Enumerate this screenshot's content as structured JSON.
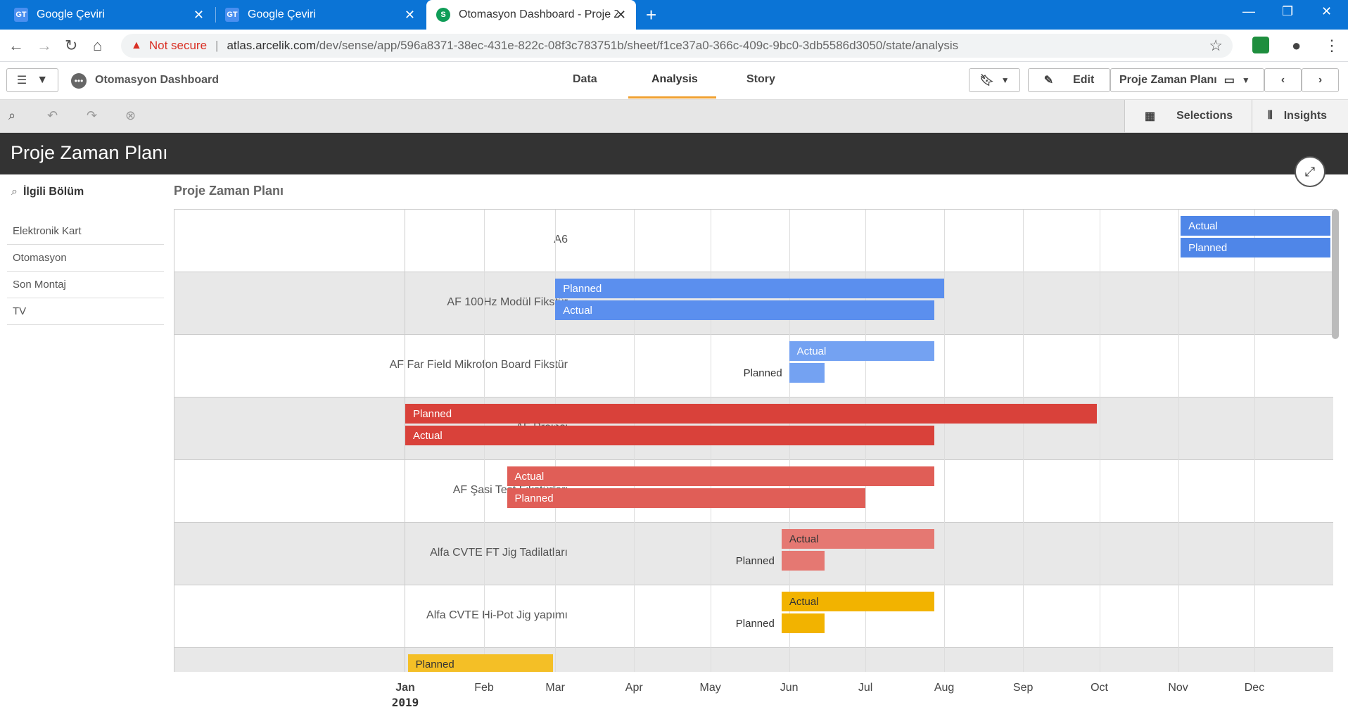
{
  "browser": {
    "tabs": [
      {
        "title": "Google Çeviri",
        "favicon": "GT"
      },
      {
        "title": "Google Çeviri",
        "favicon": "GT"
      },
      {
        "title": "Otomasyon Dashboard - Proje Za",
        "favicon": "S"
      }
    ],
    "new_tab": "+",
    "not_secure": "Not secure",
    "url_host": "atlas.arcelik.com",
    "url_path": "/dev/sense/app/596a8371-38ec-431e-822c-08f3c783751b/sheet/f1ce37a0-366c-409c-9bc0-3db5586d3050/state/analysis"
  },
  "app": {
    "name": "Otomasyon Dashboard",
    "nav_tabs": [
      "Data",
      "Analysis",
      "Story"
    ],
    "active_tab": "Analysis",
    "edit_label": "Edit",
    "sheet_selector": "Proje Zaman Planı",
    "selections_label": "Selections",
    "insights_label": "Insights"
  },
  "sheet": {
    "title": "Proje Zaman Planı"
  },
  "filter": {
    "title": "İlgili Bölüm",
    "items": [
      "Elektronik Kart",
      "Otomasyon",
      "Son Montaj",
      "TV"
    ]
  },
  "chart_data": {
    "type": "gantt",
    "title": "Proje Zaman Planı",
    "x_ticks": [
      "Jan",
      "Feb",
      "Mar",
      "Apr",
      "May",
      "Jun",
      "Jul",
      "Aug",
      "Sep",
      "Oct",
      "Nov",
      "Dec"
    ],
    "x_year": "2019",
    "rows": [
      {
        "name": "A6",
        "color": "#4f86e8",
        "bars": [
          {
            "label": "Actual",
            "start": "2019-11-02",
            "end": "2019-12-31"
          },
          {
            "label": "Planned",
            "start": "2019-11-02",
            "end": "2019-12-31"
          }
        ]
      },
      {
        "name": "AF 100Hz Modül Fikstür",
        "color": "#5b8fee",
        "bars": [
          {
            "label": "Planned",
            "start": "2019-03-01",
            "end": "2019-08-01"
          },
          {
            "label": "Actual",
            "start": "2019-03-01",
            "end": "2019-07-28"
          }
        ]
      },
      {
        "name": "AF Far Field Mikrofon Board Fikstür",
        "color": "#74a2f2",
        "bars": [
          {
            "label": "Actual",
            "start": "2019-06-01",
            "end": "2019-07-28"
          },
          {
            "label": "Planned",
            "start": "2019-06-01",
            "end": "2019-06-15"
          }
        ]
      },
      {
        "name": "AF Projesi",
        "color": "#d9413a",
        "bars": [
          {
            "label": "Planned",
            "start": "2019-01-01",
            "end": "2019-09-30"
          },
          {
            "label": "Actual",
            "start": "2019-01-01",
            "end": "2019-07-28"
          }
        ]
      },
      {
        "name": "AF Şasi Test Fikstürleri",
        "color": "#e05e57",
        "bars": [
          {
            "label": "Actual",
            "start": "2019-02-10",
            "end": "2019-07-28"
          },
          {
            "label": "Planned",
            "start": "2019-02-10",
            "end": "2019-07-01"
          }
        ]
      },
      {
        "name": "Alfa CVTE FT Jig Tadilatları",
        "color": "#e57872",
        "bars": [
          {
            "label": "Actual",
            "start": "2019-05-29",
            "end": "2019-07-28"
          },
          {
            "label": "Planned",
            "start": "2019-05-29",
            "end": "2019-06-15"
          }
        ]
      },
      {
        "name": "Alfa CVTE Hi-Pot Jig yapımı",
        "color": "#f2b300",
        "bars": [
          {
            "label": "Actual",
            "start": "2019-05-29",
            "end": "2019-07-28"
          },
          {
            "label": "Planned",
            "start": "2019-05-29",
            "end": "2019-06-15"
          }
        ]
      },
      {
        "name": "",
        "color": "#f4bf26",
        "bars": [
          {
            "label": "Planned",
            "start": "2019-01-02",
            "end": "2019-02-28"
          }
        ]
      }
    ]
  }
}
